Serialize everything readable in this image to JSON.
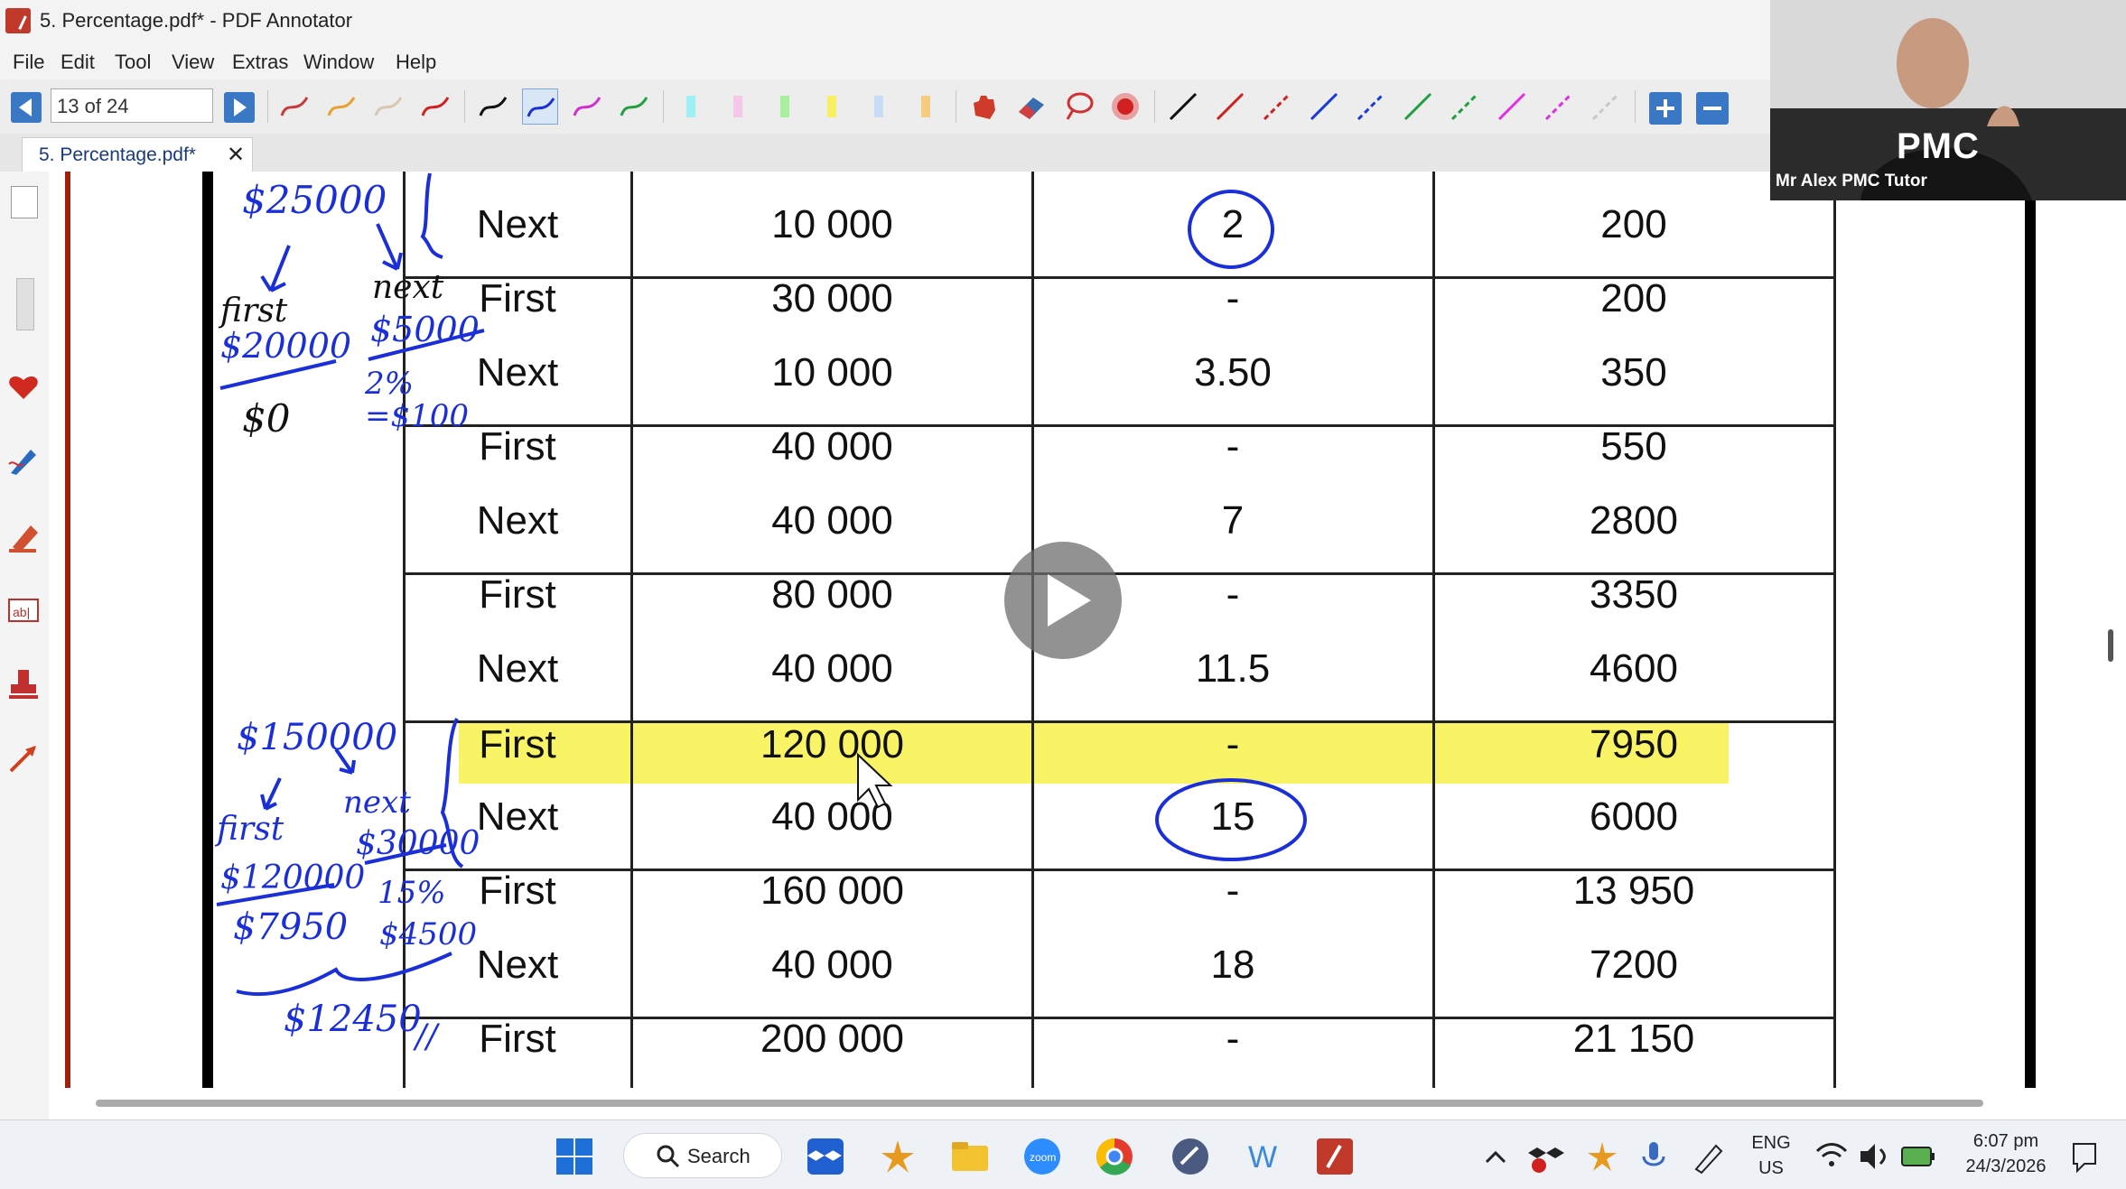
{
  "window": {
    "title": "5. Percentage.pdf* - PDF Annotator"
  },
  "menu": [
    "File",
    "Edit",
    "Tool",
    "View",
    "Extras",
    "Window",
    "Help"
  ],
  "toolbar": {
    "page_indicator": "13 of 24"
  },
  "tab": {
    "label": "5. Percentage.pdf*",
    "close": "✕"
  },
  "webcam": {
    "label": "Mr Alex PMC Tutor",
    "logo": "PMC"
  },
  "table": {
    "rows": [
      [
        "Next",
        "10 000",
        "2",
        "200"
      ],
      [
        "First",
        "30 000",
        "-",
        "200"
      ],
      [
        "Next",
        "10 000",
        "3.50",
        "350"
      ],
      [
        "First",
        "40 000",
        "-",
        "550"
      ],
      [
        "Next",
        "40 000",
        "7",
        "2800"
      ],
      [
        "First",
        "80 000",
        "-",
        "3350"
      ],
      [
        "Next",
        "40 000",
        "11.5",
        "4600"
      ],
      [
        "First",
        "120 000",
        "-",
        "7950"
      ],
      [
        "Next",
        "40 000",
        "15",
        "6000"
      ],
      [
        "First",
        "160 000",
        "-",
        "13 950"
      ],
      [
        "Next",
        "40 000",
        "18",
        "7200"
      ],
      [
        "First",
        "200 000",
        "-",
        "21 150"
      ]
    ]
  },
  "annotations": {
    "top_total": "$25000",
    "first_word": "first",
    "first_amount": "$20000",
    "next_word": "next",
    "next_amount": "$5000",
    "rate_line": "2%",
    "rate_result": "=$100",
    "zero_tax": "$0",
    "bottom_total": "$150000",
    "bottom_first_word": "first",
    "bottom_first_amount": "$120000",
    "bottom_first_tax": "$7950",
    "bottom_next_word": "next",
    "bottom_next_amount": "$30000",
    "bottom_rate": "15%",
    "bottom_next_tax": "$4500",
    "bottom_sum": "$12450",
    "bottom_mark": "//"
  },
  "taskbar": {
    "search": "Search",
    "lang_top": "ENG",
    "lang_bottom": "US",
    "time": "6:07 pm",
    "date": "24/3/2026"
  }
}
